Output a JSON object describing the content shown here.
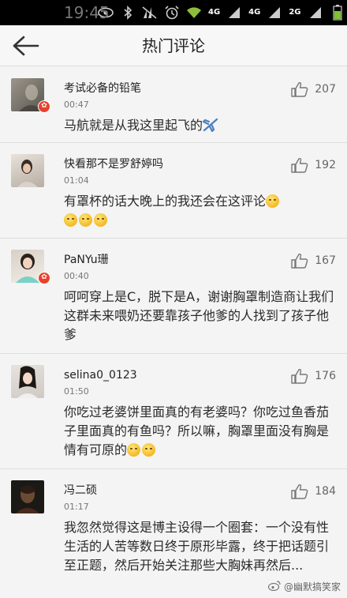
{
  "status_bar": {
    "time": "19:45",
    "net1": "4G",
    "net2": "4G",
    "net3": "2G",
    "icons": [
      "eye-icon",
      "bluetooth-icon",
      "mute-icon",
      "alarm-icon",
      "wifi-icon",
      "signal-icon",
      "battery-icon"
    ]
  },
  "header": {
    "title": "热门评论",
    "back_icon": "back-arrow-icon"
  },
  "comments": [
    {
      "name": "考试必备的铅笔",
      "time": "00:47",
      "likes": "207",
      "text": "马航就是从我这里起飞的",
      "verified": true
    },
    {
      "name": "快看那不是罗舒婷吗",
      "time": "01:04",
      "likes": "192",
      "text": "有罩杯的话大晚上的我还会在这评论",
      "verified": false
    },
    {
      "name": "PaNYu珊",
      "time": "00:40",
      "likes": "167",
      "text": "呵呵穿上是C，脱下是A，谢谢胸罩制造商让我们这群未来喂奶还要靠孩子他爹的人找到了孩子他爹",
      "verified": true
    },
    {
      "name": "selina0_0123",
      "time": "01:50",
      "likes": "176",
      "text": "你吃过老婆饼里面真的有老婆吗？你吃过鱼香茄子里面真的有鱼吗？所以嘛，胸罩里面没有胸是情有可原的",
      "verified": false
    },
    {
      "name": "冯二硕",
      "time": "01:17",
      "likes": "184",
      "text": "我忽然觉得这是博主设得一个圈套：一个没有性生活的人苦等数日终于原形毕露，终于把话题引至正题，然后开始关注那些大胸妹再然后...",
      "verified": false
    }
  ],
  "watermark": "@幽默搞笑家",
  "colors": {
    "badge": "#e8412e",
    "background": "#f4f4f4",
    "statusbar": "#000000"
  }
}
